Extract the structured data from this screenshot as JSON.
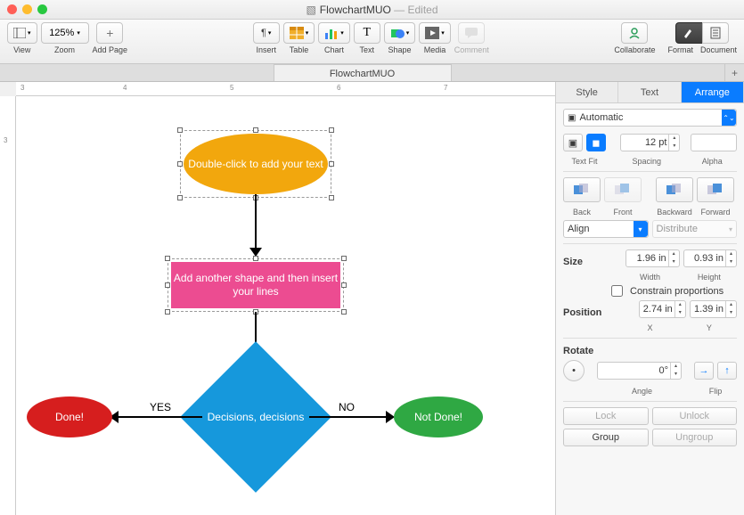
{
  "window": {
    "title": "FlowchartMUO",
    "status": "Edited"
  },
  "toolbar": {
    "view_label": "View",
    "zoom_label": "Zoom",
    "zoom_value": "125%",
    "addpage_label": "Add Page",
    "insert_label": "Insert",
    "table_label": "Table",
    "chart_label": "Chart",
    "text_label": "Text",
    "shape_label": "Shape",
    "media_label": "Media",
    "comment_label": "Comment",
    "collaborate_label": "Collaborate",
    "format_label": "Format",
    "document_label": "Document"
  },
  "doctab": {
    "name": "FlowchartMUO"
  },
  "ruler_h": [
    "3",
    "4",
    "5",
    "6",
    "7"
  ],
  "ruler_v": [
    "3"
  ],
  "flowchart": {
    "start": "Double-click to add your text",
    "process": "Add another shape and then insert your lines",
    "decision": "Decisions, decisions",
    "yes_label": "YES",
    "no_label": "NO",
    "done": "Done!",
    "notdone": "Not Done!"
  },
  "inspector": {
    "tabs": {
      "style": "Style",
      "text": "Text",
      "arrange": "Arrange"
    },
    "wrap_mode": "Automatic",
    "textfit_label": "Text Fit",
    "spacing_label": "Spacing",
    "spacing_value": "12 pt",
    "alpha_label": "Alpha",
    "back": "Back",
    "front": "Front",
    "backward": "Backward",
    "forward": "Forward",
    "align_label": "Align",
    "distribute_label": "Distribute",
    "size_label": "Size",
    "width_value": "1.96 in",
    "width_label": "Width",
    "height_value": "0.93 in",
    "height_label": "Height",
    "constrain_label": "Constrain proportions",
    "position_label": "Position",
    "x_value": "2.74 in",
    "x_label": "X",
    "y_value": "1.39 in",
    "y_label": "Y",
    "rotate_label": "Rotate",
    "angle_value": "0°",
    "angle_label": "Angle",
    "flip_label": "Flip",
    "lock": "Lock",
    "unlock": "Unlock",
    "group": "Group",
    "ungroup": "Ungroup"
  }
}
